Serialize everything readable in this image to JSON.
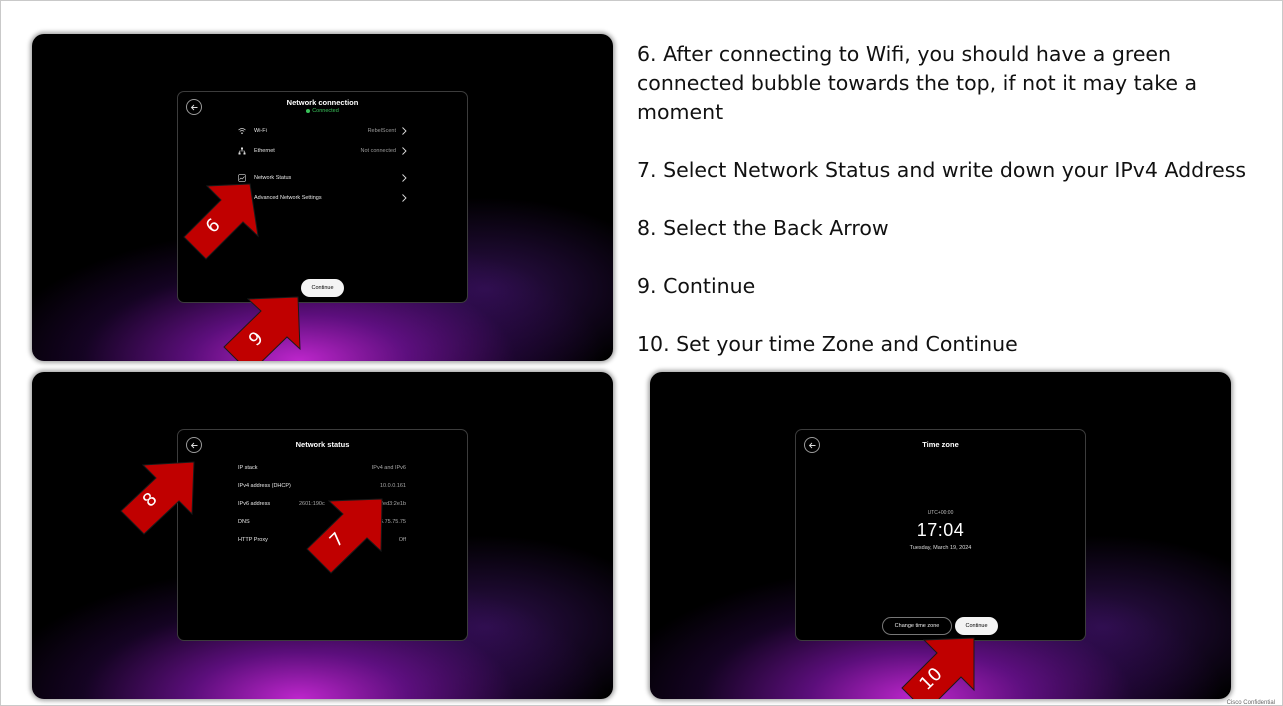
{
  "instructions": [
    "6. After connecting to Wifi, you should have a green connected bubble towards the top, if not it may take a moment",
    "7. Select Network Status and write down your IPv4 Address",
    "8. Select the Back Arrow",
    "9. Continue",
    "10. Set your time Zone and Continue"
  ],
  "screen_network_connection": {
    "title": "Network connection",
    "status": "Connected",
    "status_color": "#39c35a",
    "rows": [
      {
        "icon": "wifi-icon",
        "label": "Wi-Fi",
        "value": "RebelScent"
      },
      {
        "icon": "ethernet-icon",
        "label": "Ethernet",
        "value": "Not connected"
      },
      {
        "icon": "network-status-icon",
        "label": "Network Status",
        "value": ""
      },
      {
        "icon": "settings-icon",
        "label": "Advanced Network Settings",
        "value": ""
      }
    ],
    "continue_label": "Continue"
  },
  "screen_network_status": {
    "title": "Network status",
    "rows": [
      {
        "label": "IP stack",
        "value": "IPv4 and IPv6"
      },
      {
        "label": "IPv4 address (DHCP)",
        "value": "10.0.0.161"
      },
      {
        "label": "IPv6 address",
        "value": "2601:190c",
        "value_end": "fed3:2e1b"
      },
      {
        "label": "DNS",
        "value": "5.75.75.75"
      },
      {
        "label": "HTTP Proxy",
        "value": "Off"
      }
    ]
  },
  "screen_time_zone": {
    "title": "Time zone",
    "zone": "UTC+00:00",
    "time": "17:04",
    "date": "Tuesday, March 19, 2024",
    "change_label": "Change time zone",
    "continue_label": "Continue"
  },
  "callouts": [
    "6",
    "9",
    "8",
    "7",
    "10"
  ],
  "accent_colors": {
    "callout_fill": "#c00000",
    "callout_text": "#ffffff"
  },
  "footer": "Cisco Confidential"
}
